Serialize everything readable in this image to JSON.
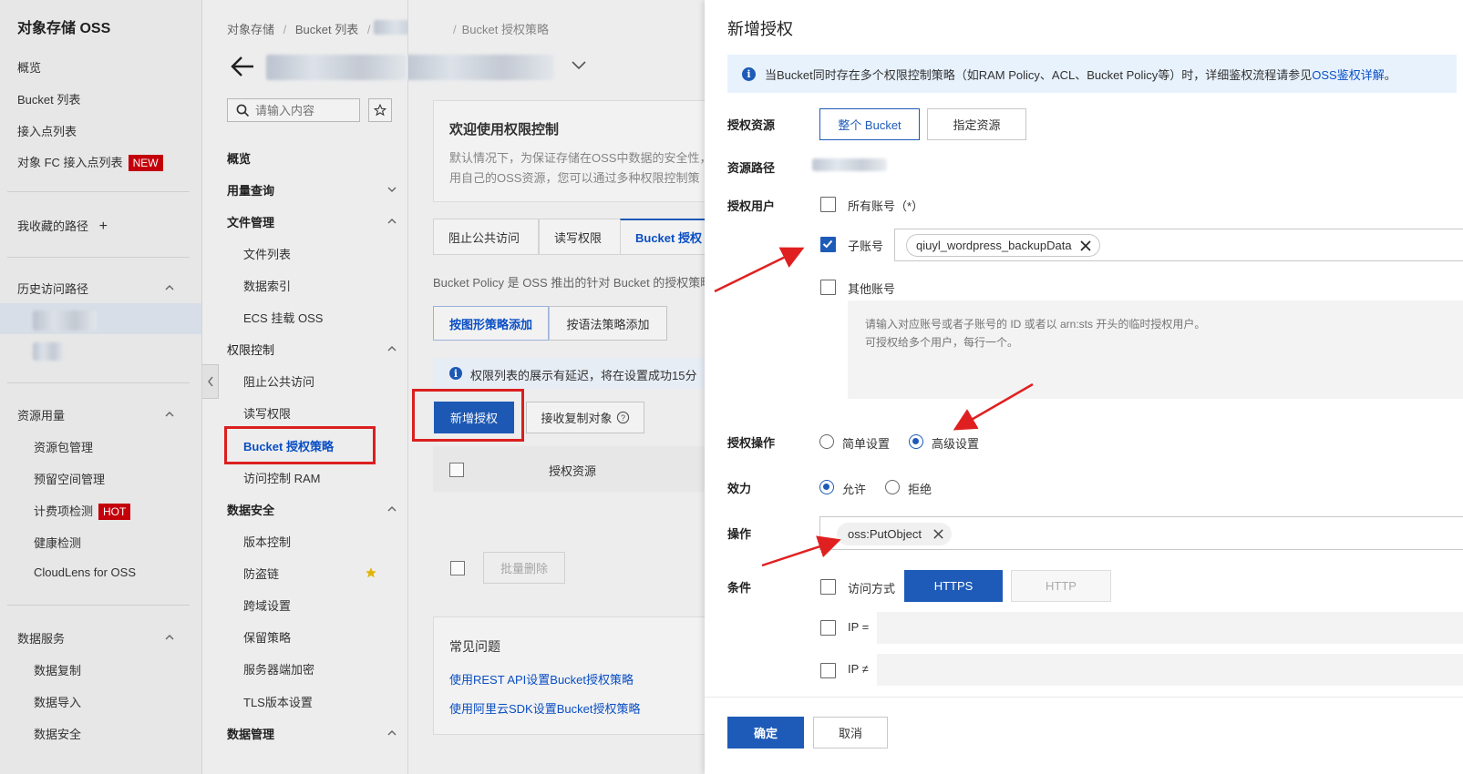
{
  "nav": {
    "title": "对象存储 OSS",
    "items": [
      "概览",
      "Bucket 列表",
      "接入点列表"
    ],
    "fc_item": "对象 FC 接入点列表",
    "fc_badge": "NEW",
    "favorites": "我收藏的路径",
    "favorites_add": "+",
    "history": "历史访问路径",
    "resource_usage": "资源用量",
    "resource_items": [
      "资源包管理",
      "预留空间管理",
      "计费项检测",
      "健康检测",
      "CloudLens for OSS"
    ],
    "hot_badge": "HOT",
    "data_services": "数据服务",
    "data_items": [
      "数据复制",
      "数据导入",
      "数据安全"
    ]
  },
  "bucket_nav": {
    "search_placeholder": "请输入内容",
    "overview": "概览",
    "usage_query": "用量查询",
    "file_mgmt": "文件管理",
    "file_items": [
      "文件列表",
      "数据索引",
      "ECS 挂载 OSS"
    ],
    "permission": "权限控制",
    "permission_items": [
      "阻止公共访问",
      "读写权限",
      "Bucket 授权策略",
      "访问控制 RAM"
    ],
    "data_security": "数据安全",
    "security_items": [
      "版本控制",
      "防盗链",
      "跨域设置",
      "保留策略",
      "服务器端加密",
      "TLS版本设置"
    ],
    "data_mgmt": "数据管理"
  },
  "main": {
    "breadcrumb": [
      "对象存储",
      "Bucket 列表",
      "Bucket 授权策略"
    ],
    "welcome_title": "欢迎使用权限控制",
    "welcome_line1": "默认情况下，为保证存储在OSS中数据的安全性，",
    "welcome_line2": "用自己的OSS资源，您可以通过多种权限控制策",
    "tabs": [
      "阻止公共访问",
      "读写权限",
      "Bucket 授权"
    ],
    "policy_desc": "Bucket Policy 是 OSS 推出的针对 Bucket 的授权策略",
    "graphic_add": "按图形策略添加",
    "syntax_add": "按语法策略添加",
    "delay_notice": "权限列表的展示有延迟，将在设置成功15分",
    "new_auth": "新增授权",
    "receive_copy": "接收复制对象",
    "col_resource": "授权资源",
    "batch_delete": "批量删除",
    "faq_title": "常见问题",
    "faq_links": [
      "使用REST API设置Bucket授权策略",
      "使用阿里云SDK设置Bucket授权策略"
    ]
  },
  "drawer": {
    "title": "新增授权",
    "info_prefix": "当Bucket同时存在多个权限控制策略（如RAM Policy、ACL、Bucket Policy等）时，详细鉴权流程请参见",
    "info_link": "OSS鉴权详解",
    "info_suffix": "。",
    "resource_label": "授权资源",
    "resource_whole": "整个 Bucket",
    "resource_specific": "指定资源",
    "path_label": "资源路径",
    "user_label": "授权用户",
    "all_accounts": "所有账号（*）",
    "sub_account": "子账号",
    "sub_account_tag": "qiuyl_wordpress_backupData",
    "other_account": "其他账号",
    "other_placeholder": "请输入对应账号或者子账号的 ID 或者以 arn:sts 开头的临时授权用户。\n可授权给多个用户，每行一个。",
    "operation_label": "授权操作",
    "simple_setting": "简单设置",
    "advanced_setting": "高级设置",
    "effect_label": "效力",
    "allow": "允许",
    "deny": "拒绝",
    "action_label": "操作",
    "action_tag": "oss:PutObject",
    "condition_label": "条件",
    "access_method": "访问方式",
    "https": "HTTPS",
    "http": "HTTP",
    "ip_eq": "IP =",
    "ip_neq": "IP ≠",
    "confirm": "确定",
    "cancel": "取消"
  },
  "colors": {
    "accent": "#1e5bb8",
    "link": "#0a50c8",
    "annotation": "#e02020",
    "badge": "#c7000b",
    "info_bg": "#e8f2fd"
  }
}
